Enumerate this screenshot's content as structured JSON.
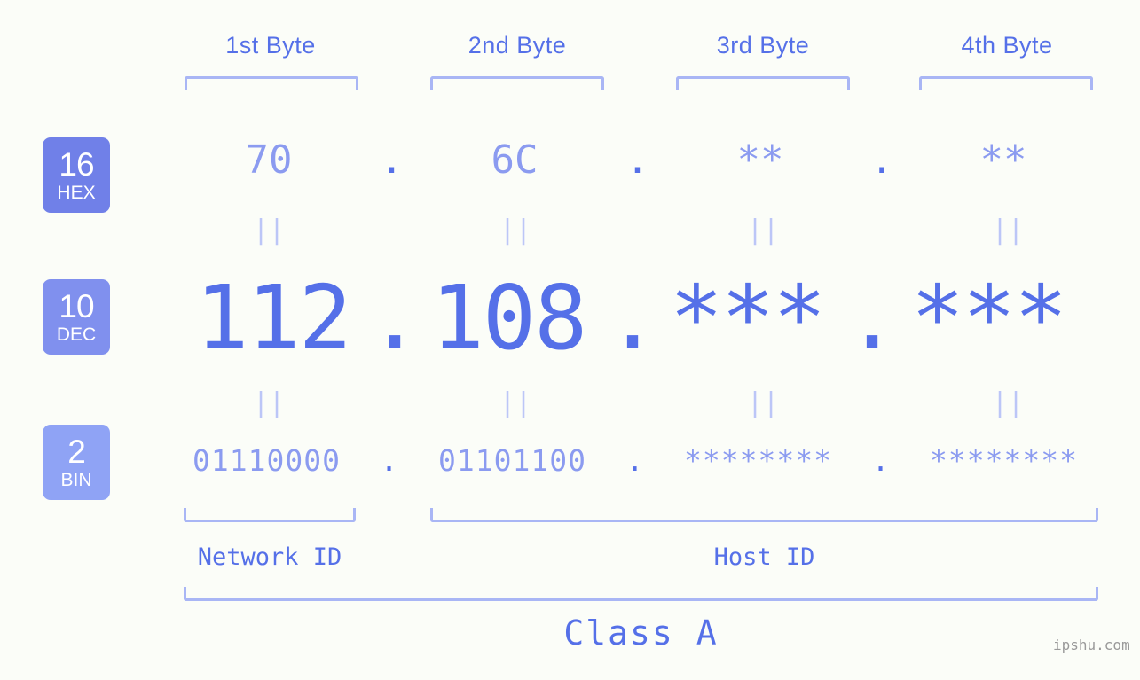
{
  "theme": {
    "background": "#fbfdf8",
    "accent_strong": "#5570e8",
    "accent_light": "#8b9bf0",
    "bracket": "#a9b6f5",
    "connector": "#bcc6f7",
    "badge_hex": "#7080e8",
    "badge_dec": "#8090ee",
    "badge_bin": "#8fa3f5",
    "watermark": "#9a9a9a"
  },
  "byte_headers": [
    {
      "label": "1st Byte"
    },
    {
      "label": "2nd Byte"
    },
    {
      "label": "3rd Byte"
    },
    {
      "label": "4th Byte"
    }
  ],
  "bases": [
    {
      "number": "16",
      "name": "HEX"
    },
    {
      "number": "10",
      "name": "DEC"
    },
    {
      "number": "2",
      "name": "BIN"
    }
  ],
  "rows": {
    "hex": {
      "octets": [
        "70",
        "6C",
        "**",
        "**"
      ],
      "separator": "."
    },
    "dec": {
      "octets": [
        "112",
        "108",
        "***",
        "***"
      ],
      "separator": "."
    },
    "bin": {
      "octets": [
        "01110000",
        "01101100",
        "********",
        "********"
      ],
      "separator": "."
    }
  },
  "connector_symbol": "||",
  "segments": {
    "network_id": "Network ID",
    "host_id": "Host ID",
    "class": "Class A"
  },
  "watermark": "ipshu.com",
  "chart_data": {
    "type": "table",
    "title": "IP address 112.108.*.* byte breakdown",
    "columns": [
      "1st Byte",
      "2nd Byte",
      "3rd Byte",
      "4th Byte"
    ],
    "rows": [
      {
        "base": "16 HEX",
        "values": [
          "70",
          "6C",
          "**",
          "**"
        ]
      },
      {
        "base": "10 DEC",
        "values": [
          "112",
          "108",
          "***",
          "***"
        ]
      },
      {
        "base": "2 BIN",
        "values": [
          "01110000",
          "01101100",
          "********",
          "********"
        ]
      }
    ],
    "annotations": {
      "network_id_bytes": [
        "1st Byte"
      ],
      "host_id_bytes": [
        "2nd Byte",
        "3rd Byte",
        "4th Byte"
      ],
      "class": "Class A"
    }
  }
}
